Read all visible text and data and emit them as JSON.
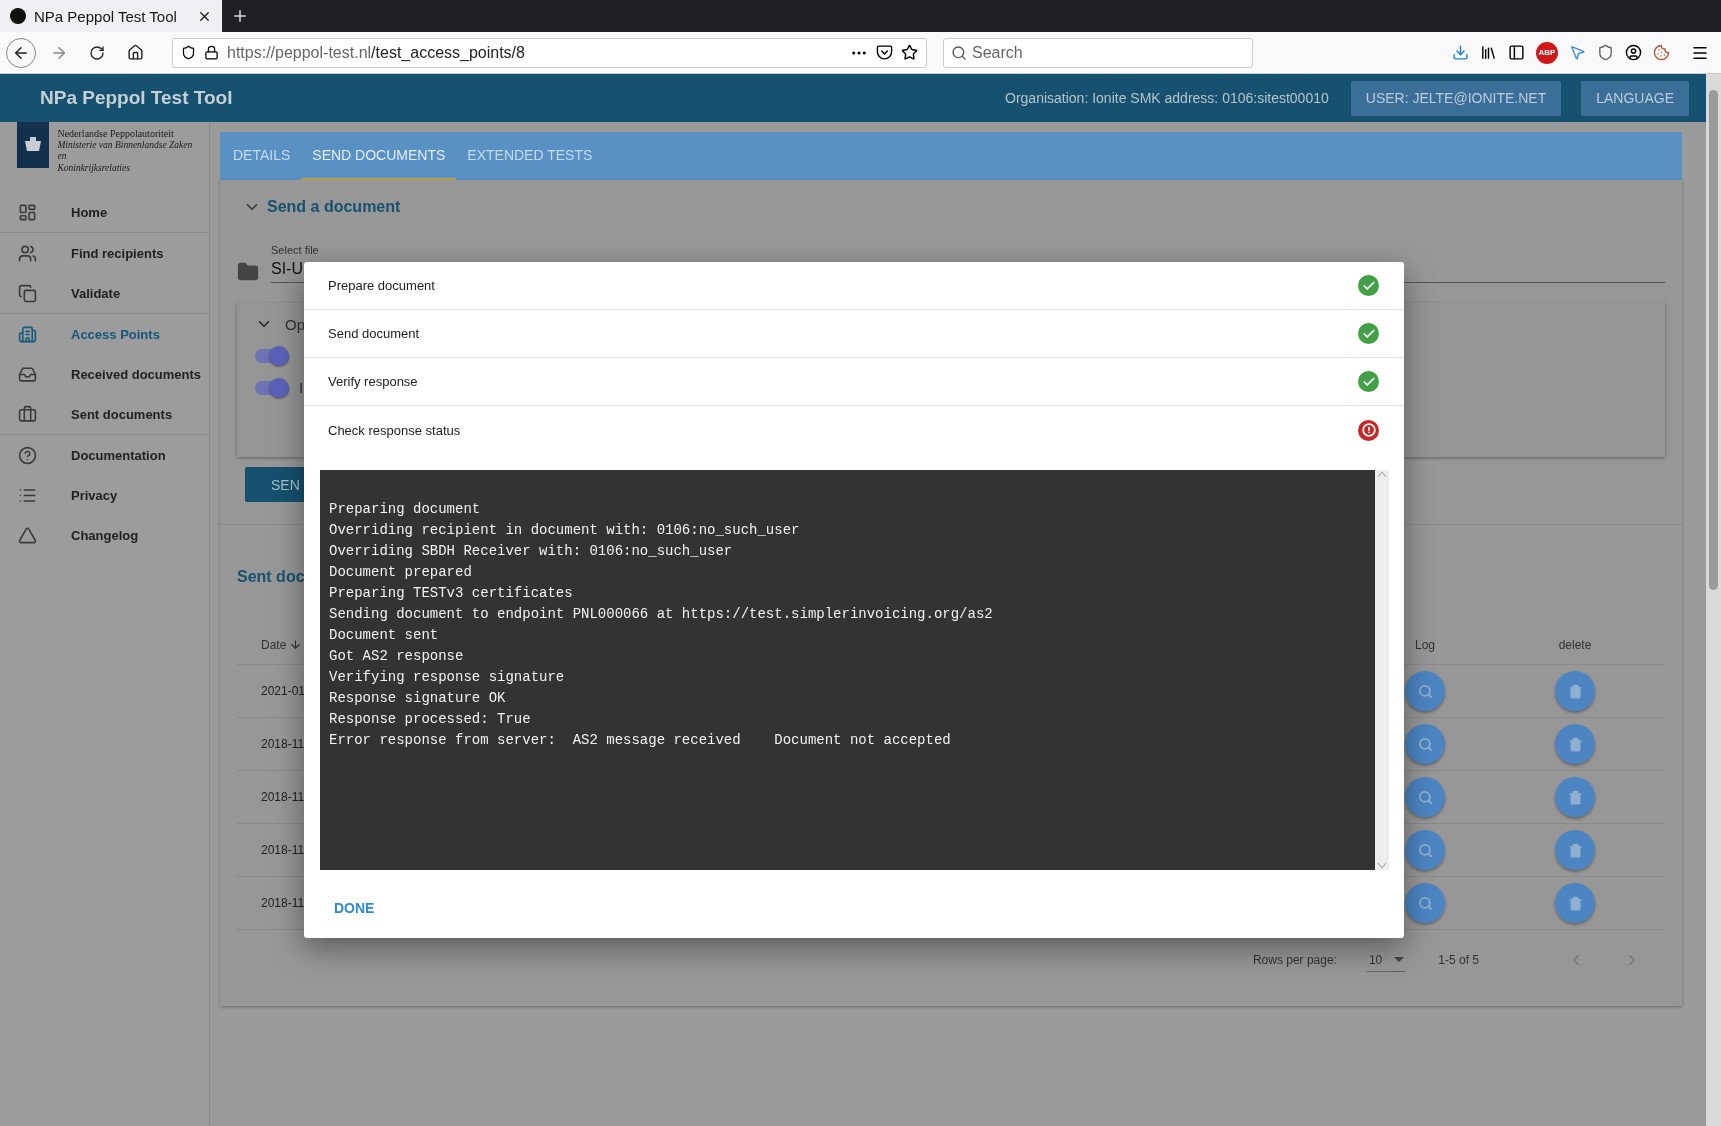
{
  "browser": {
    "tab_title": "NPa Peppol Test Tool",
    "url_host": "https://peppol-test.nl",
    "url_path": "/test_access_points/8",
    "search_placeholder": "Search",
    "extension_badge": "ABP"
  },
  "header": {
    "title": "NPa Peppol Test Tool",
    "organisation": "Organisation: Ionite SMK address: 0106:sitest00010",
    "user_button": "USER: JELTE@IONITE.NET",
    "language_button": "LANGUAGE"
  },
  "sidebar": {
    "org_name": "Nederlandse Peppolautoriteit",
    "ministry_lines": [
      "Ministerie van Binnenlandse Zaken en",
      "Koninkrijksrelaties"
    ],
    "groups": [
      [
        {
          "label": "Home",
          "selected": false
        }
      ],
      [
        {
          "label": "Find recipients",
          "selected": false
        },
        {
          "label": "Validate",
          "selected": false
        }
      ],
      [
        {
          "label": "Access Points",
          "selected": true
        },
        {
          "label": "Received documents",
          "selected": false
        },
        {
          "label": "Sent documents",
          "selected": false
        }
      ],
      [
        {
          "label": "Documentation",
          "selected": false
        },
        {
          "label": "Privacy",
          "selected": false
        },
        {
          "label": "Changelog",
          "selected": false
        }
      ]
    ]
  },
  "tabs": [
    {
      "label": "DETAILS",
      "selected": false
    },
    {
      "label": "SEND DOCUMENTS",
      "selected": true
    },
    {
      "label": "EXTENDED TESTS",
      "selected": false
    }
  ],
  "send_panel": {
    "heading": "Send a document",
    "file_label": "Select file",
    "file_value": "SI-U",
    "options_label": "Op",
    "toggles": [
      {
        "on": true
      },
      {
        "label": "I",
        "on": true
      }
    ],
    "send_button": "SEN"
  },
  "sent_panel": {
    "heading": "Sent doc",
    "columns": [
      "Date",
      "Log",
      "delete"
    ],
    "rows": [
      {
        "date": "2021-01"
      },
      {
        "date": "2018-11"
      },
      {
        "date": "2018-11"
      },
      {
        "date": "2018-11"
      },
      {
        "date": "2018-11"
      }
    ],
    "rows_per_page_label": "Rows per page:",
    "rows_per_page": "10",
    "range": "1-5 of 5"
  },
  "dialog": {
    "steps": [
      {
        "label": "Prepare document",
        "passed": true
      },
      {
        "label": "Send document",
        "passed": true
      },
      {
        "label": "Verify response",
        "passed": true
      },
      {
        "label": "Check response status",
        "passed": false
      }
    ],
    "log": [
      "Preparing document",
      "Overriding recipient in document with: 0106:no_such_user",
      "Overriding SBDH Receiver with: 0106:no_such_user",
      "Document prepared",
      "Preparing TESTv3 certificates",
      "Sending document to endpoint PNL000066 at https://test.simplerinvoicing.org/as2",
      "Document sent",
      "Got AS2 response",
      "Verifying response signature",
      "Response signature OK",
      "Response processed: True",
      "Error response from server:  AS2 message received    Document not accepted"
    ],
    "done_button": "DONE"
  }
}
